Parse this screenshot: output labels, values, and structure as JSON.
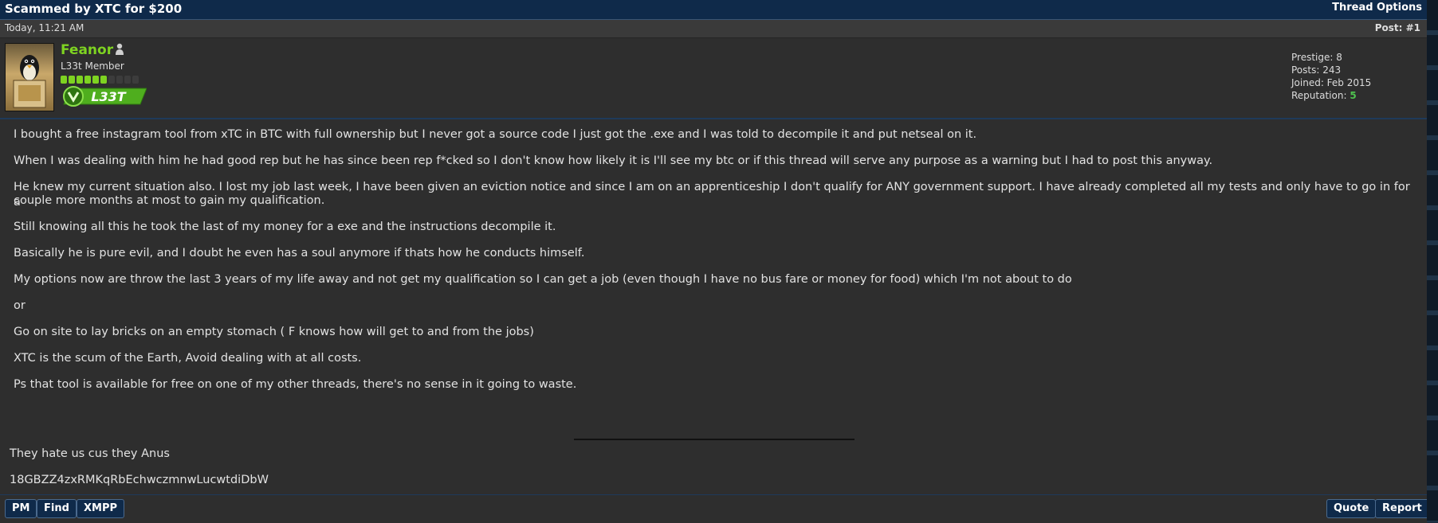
{
  "thread": {
    "title": "Scammed by XTC for $200",
    "options_label": "Thread Options"
  },
  "post": {
    "date": "Today, 11:21 AM",
    "number_label": "Post: #1"
  },
  "user": {
    "name": "Feanor",
    "title": "L33t Member",
    "rank_badge": "L33T",
    "rep_dots": {
      "filled": 6,
      "total": 10
    },
    "stats": {
      "prestige": "Prestige: 8",
      "posts": "Posts: 243",
      "joined": "Joined: Feb 2015",
      "reputation_label": "Reputation:",
      "reputation_value": "5"
    }
  },
  "message": {
    "paragraphs": [
      "I bought a free instagram tool from xTC in BTC with full ownership but I never got a source code I just got the .exe and I was told to decompile it and put netseal on it.",
      "When I was dealing with him he had good rep but he has since been rep f*cked so I don't know how likely it is I'll see my btc or if this thread will serve any purpose as a warning but I had to post this anyway.",
      "He knew my current situation also. I lost my job last week, I have been given an eviction notice and since I am on an apprenticeship I don't qualify for ANY government support. I have already completed all my tests and only have to go in for a",
      "couple more months at most to gain my qualification.",
      "Still knowing all this he took the last of my money for a exe and the instructions decompile it.",
      "Basically he is pure evil, and I doubt he even has a soul anymore if thats how he conducts himself.",
      "My options now are throw the last 3 years of my life away and not get my qualification so I can get a job (even though I have no bus fare or money for food) which I'm not about to do",
      "or",
      "Go on site to lay bricks on an empty stomach ( F knows how will get to and from the jobs)",
      "XTC is the scum of the Earth, Avoid dealing with at all costs.",
      "Ps that tool is available for free on one of my other threads, there's no sense in it going to waste."
    ]
  },
  "signature": {
    "line1": "They hate us cus they Anus",
    "line2": "18GBZZ4zxRMKqRbEchwczmnwLucwtdiDbW"
  },
  "footer": {
    "pm": "PM",
    "find": "Find",
    "xmpp": "XMPP",
    "quote": "Quote",
    "report": "Report"
  },
  "colors": {
    "header_bg": "#0f2a4a",
    "username": "#7ed321",
    "reputation": "#4fc24f",
    "button_bg": "#0f2a4a"
  }
}
